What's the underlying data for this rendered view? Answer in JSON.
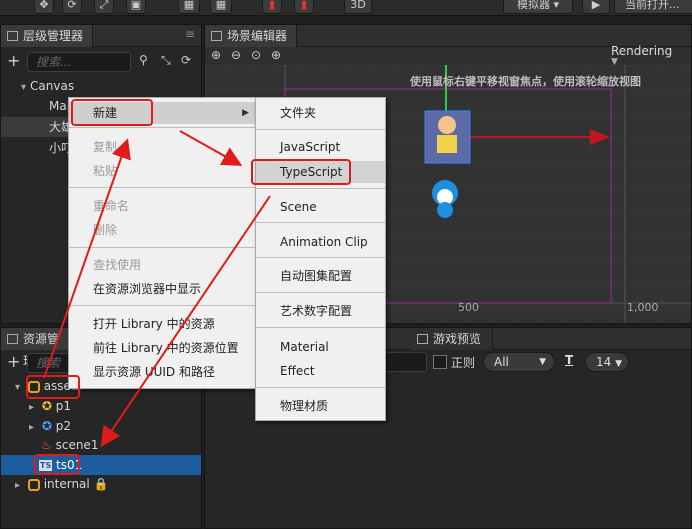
{
  "toolbar": {
    "view_3d": "3D",
    "simulator": "模拟器 ▾",
    "open_current": "当前打开..."
  },
  "hierarchy": {
    "title": "层级管理器",
    "search_placeholder": "搜索...",
    "nodes": [
      {
        "label": "Canvas"
      },
      {
        "label": "Mai"
      },
      {
        "label": "大雄"
      },
      {
        "label": "小叮"
      }
    ]
  },
  "scene": {
    "title": "场景编辑器",
    "rendering": "Rendering",
    "hint": "使用鼠标右键平移视窗焦点，使用滚轮缩放视图",
    "ruler_500": "500",
    "ruler_1000": "1,000"
  },
  "assets": {
    "title": "资源管理",
    "search_placeholder": "搜索",
    "items": [
      {
        "label": "assets"
      },
      {
        "label": "p1"
      },
      {
        "label": "p2"
      },
      {
        "label": "scene1"
      },
      {
        "label": "ts01"
      },
      {
        "label": "internal"
      }
    ]
  },
  "console": {
    "tab_preview": "游戏预览",
    "regex_label": "正则",
    "filter_value": "All",
    "font_size": "14",
    "font_icon_label": "T"
  },
  "context_menu": {
    "items": [
      {
        "label": "新建",
        "enabled": true
      },
      {
        "label": "复制",
        "enabled": false
      },
      {
        "label": "粘贴",
        "enabled": false
      },
      {
        "label": "重命名",
        "enabled": false
      },
      {
        "label": "删除",
        "enabled": false
      },
      {
        "label": "查找使用",
        "enabled": false
      },
      {
        "label": "在资源浏览器中显示",
        "enabled": true
      },
      {
        "label": "打开 Library 中的资源",
        "enabled": true
      },
      {
        "label": "前往 Library 中的资源位置",
        "enabled": true
      },
      {
        "label": "显示资源 UUID 和路径",
        "enabled": true
      }
    ]
  },
  "submenu": {
    "items": [
      {
        "label": "文件夹"
      },
      {
        "label": "JavaScript"
      },
      {
        "label": "TypeScript"
      },
      {
        "label": "Scene"
      },
      {
        "label": "Animation Clip"
      },
      {
        "label": "自动图集配置"
      },
      {
        "label": "艺术数字配置"
      },
      {
        "label": "Material"
      },
      {
        "label": "Effect"
      },
      {
        "label": "物理材质"
      }
    ]
  },
  "colors": {
    "annotation_red": "#e01b1b",
    "selection_blue": "#1b5d9e",
    "scene_frame": "#9b2f9b"
  }
}
